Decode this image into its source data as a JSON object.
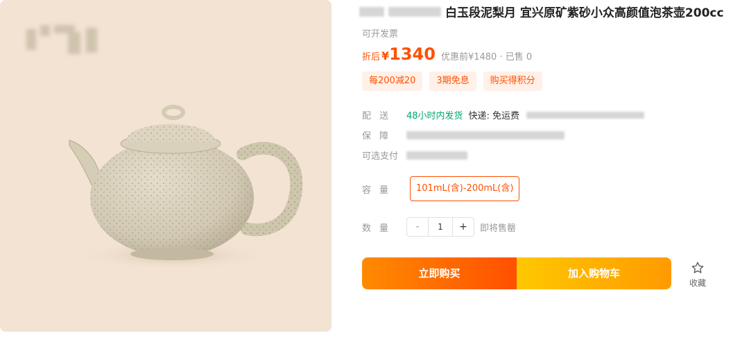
{
  "product": {
    "title_text": "白玉段泥梨月 宜兴原矿紫砂小众高颜值泡茶壶200cc",
    "invoice_text": "可开发票",
    "price_label": "折后",
    "currency": "¥",
    "price": "1340",
    "price_sub": "优惠前¥1480 · 已售 0"
  },
  "promotions": [
    "每200减20",
    "3期免息",
    "购买得积分"
  ],
  "shipping": {
    "label": "配送",
    "time": "48小时内发货",
    "fee": "快递: 免运费"
  },
  "guarantee": {
    "label": "保障"
  },
  "payment": {
    "label": "可选支付"
  },
  "spec": {
    "label": "容量",
    "selected": "101mL(含)-200mL(含)"
  },
  "quantity": {
    "label": "数量",
    "minus": "-",
    "value": "1",
    "plus": "+",
    "status": "即将售罄"
  },
  "actions": {
    "buy_now": "立即购买",
    "add_cart": "加入购物车",
    "favorite": "收藏"
  },
  "colors": {
    "accent": "#ff5000",
    "green": "#00a66f",
    "image_bg": "#f3e3d3"
  },
  "icons": {
    "favorite": "star-icon"
  }
}
